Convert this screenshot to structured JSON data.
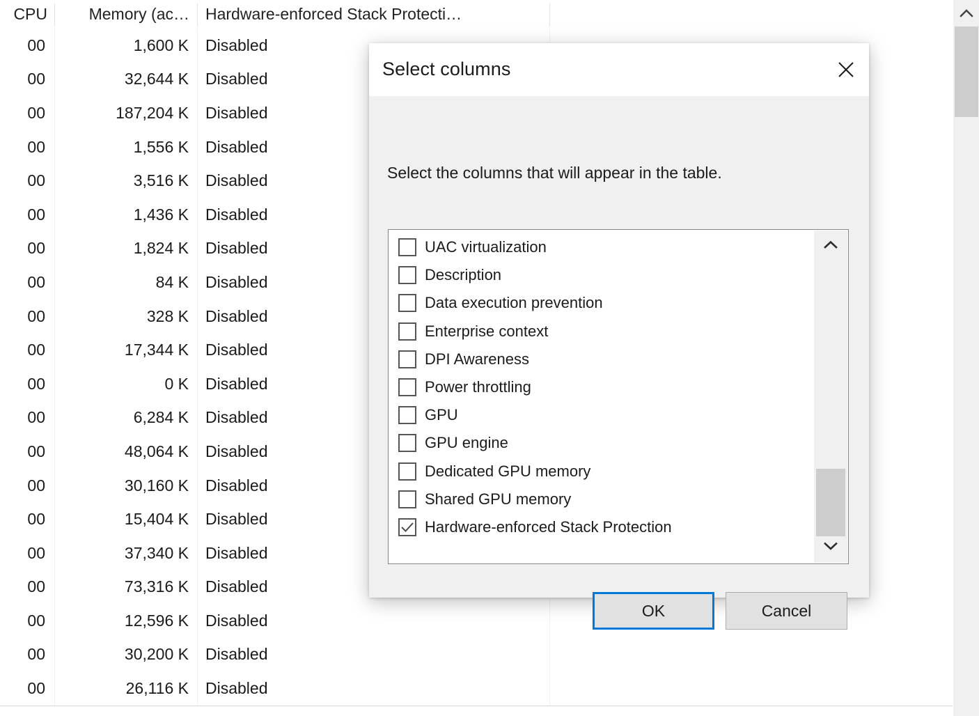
{
  "table": {
    "columns": [
      "CPU",
      "Memory (ac…",
      "Hardware-enforced Stack Protecti…"
    ],
    "rows": [
      {
        "cpu": "00",
        "memory": "1,600 K",
        "hesp": "Disabled"
      },
      {
        "cpu": "00",
        "memory": "32,644 K",
        "hesp": "Disabled"
      },
      {
        "cpu": "00",
        "memory": "187,204 K",
        "hesp": "Disabled"
      },
      {
        "cpu": "00",
        "memory": "1,556 K",
        "hesp": "Disabled"
      },
      {
        "cpu": "00",
        "memory": "3,516 K",
        "hesp": "Disabled"
      },
      {
        "cpu": "00",
        "memory": "1,436 K",
        "hesp": "Disabled"
      },
      {
        "cpu": "00",
        "memory": "1,824 K",
        "hesp": "Disabled"
      },
      {
        "cpu": "00",
        "memory": "84 K",
        "hesp": "Disabled"
      },
      {
        "cpu": "00",
        "memory": "328 K",
        "hesp": "Disabled"
      },
      {
        "cpu": "00",
        "memory": "17,344 K",
        "hesp": "Disabled"
      },
      {
        "cpu": "00",
        "memory": "0 K",
        "hesp": "Disabled"
      },
      {
        "cpu": "00",
        "memory": "6,284 K",
        "hesp": "Disabled"
      },
      {
        "cpu": "00",
        "memory": "48,064 K",
        "hesp": "Disabled"
      },
      {
        "cpu": "00",
        "memory": "30,160 K",
        "hesp": "Disabled"
      },
      {
        "cpu": "00",
        "memory": "15,404 K",
        "hesp": "Disabled"
      },
      {
        "cpu": "00",
        "memory": "37,340 K",
        "hesp": "Disabled"
      },
      {
        "cpu": "00",
        "memory": "73,316 K",
        "hesp": "Disabled"
      },
      {
        "cpu": "00",
        "memory": "12,596 K",
        "hesp": "Disabled"
      },
      {
        "cpu": "00",
        "memory": "30,200 K",
        "hesp": "Disabled"
      },
      {
        "cpu": "00",
        "memory": "26,116 K",
        "hesp": "Disabled"
      }
    ]
  },
  "main_scrollbar": {
    "up_icon": "chevron-up-icon"
  },
  "dialog": {
    "title": "Select columns",
    "close_icon": "close-icon",
    "instruction": "Select the columns that will appear in the table.",
    "list": [
      {
        "label": "UAC virtualization",
        "checked": false
      },
      {
        "label": "Description",
        "checked": false
      },
      {
        "label": "Data execution prevention",
        "checked": false
      },
      {
        "label": "Enterprise context",
        "checked": false
      },
      {
        "label": "DPI Awareness",
        "checked": false
      },
      {
        "label": "Power throttling",
        "checked": false
      },
      {
        "label": "GPU",
        "checked": false
      },
      {
        "label": "GPU engine",
        "checked": false
      },
      {
        "label": "Dedicated GPU memory",
        "checked": false
      },
      {
        "label": "Shared GPU memory",
        "checked": false
      },
      {
        "label": "Hardware-enforced Stack Protection",
        "checked": true
      }
    ],
    "list_scrollbar": {
      "up_icon": "chevron-up-icon",
      "down_icon": "chevron-down-icon"
    },
    "buttons": {
      "ok": "OK",
      "cancel": "Cancel"
    }
  },
  "colors": {
    "accent": "#0078d7",
    "dialog_body": "#f0f0f0",
    "button_face": "#e1e1e1",
    "scroll_thumb": "#cdcdcd"
  }
}
